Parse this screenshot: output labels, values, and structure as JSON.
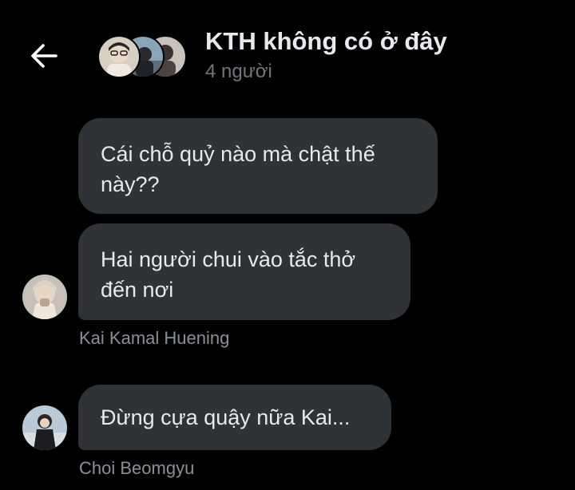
{
  "header": {
    "title": "KTH không có ở đây",
    "subtitle": "4 người",
    "back_icon": "arrow-left-icon"
  },
  "messages": [
    {
      "text": "Cái chỗ quỷ nào mà chật thế\nnày??",
      "sender": ""
    },
    {
      "text": "Hai người chui vào tắc thở\nđến nơi",
      "sender": "Kai Kamal Huening"
    },
    {
      "text": "Đừng cựa quậy nữa Kai...",
      "sender": "Choi Beomgyu"
    }
  ],
  "colors": {
    "background": "#000000",
    "bubble": "#2f3336",
    "text": "#e7e9ea",
    "muted": "#71767b"
  }
}
